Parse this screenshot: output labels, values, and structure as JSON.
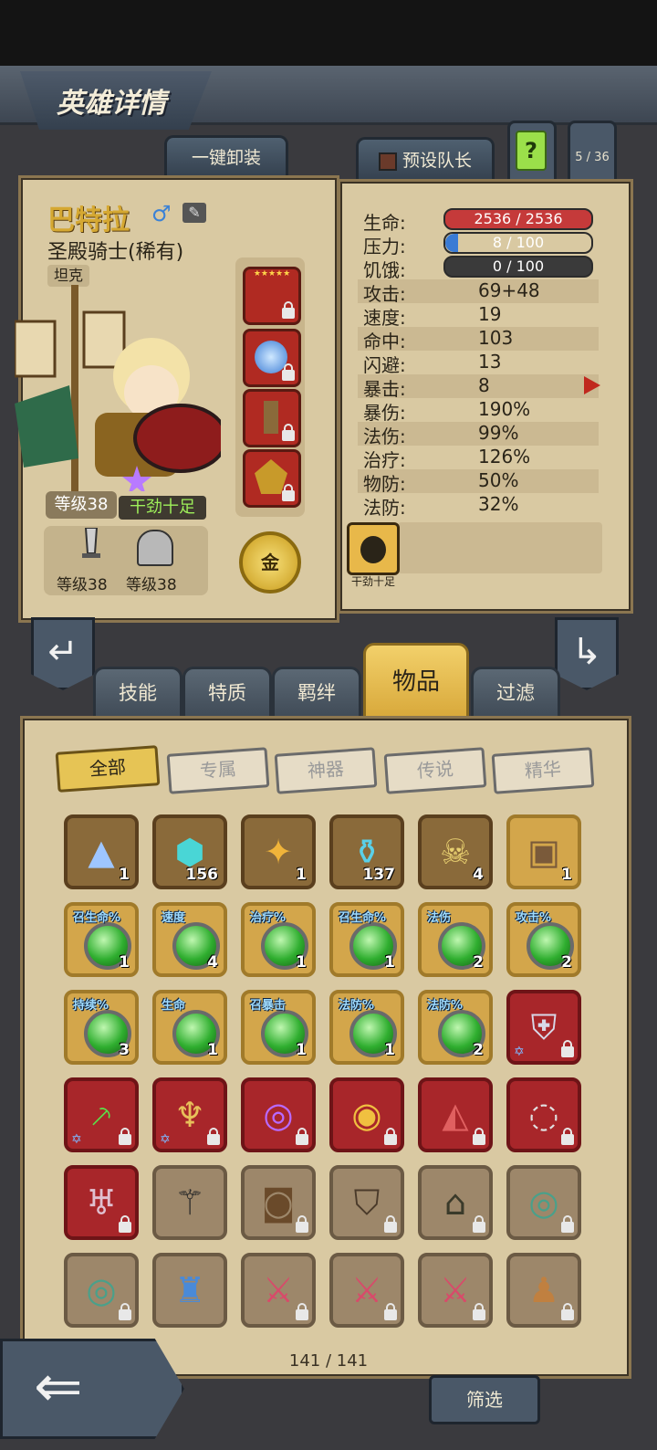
{
  "header": {
    "title": "英雄详情"
  },
  "top_buttons": {
    "unequip_all": "一键卸装",
    "preset_captain": "预设队长",
    "help": "?",
    "team_count": "5 / 36"
  },
  "hero": {
    "name": "巴特拉",
    "class_name": "圣殿骑士(稀有)",
    "role": "坦克",
    "level": "等级38",
    "mood": "干劲十足",
    "weapon_level": "等级38",
    "armor_level": "等级38",
    "gold_badge": "金",
    "trait_label": "干劲十足"
  },
  "stats": {
    "health_label": "生命:",
    "health_value": "2536 / 2536",
    "health_fraction": 1.0,
    "stress_label": "压力:",
    "stress_value": "8 / 100",
    "stress_fraction": 0.08,
    "hunger_label": "饥饿:",
    "hunger_value": "0 / 100",
    "hunger_fraction": 0.0,
    "rows": [
      {
        "label": "攻击:",
        "value": "69+48"
      },
      {
        "label": "速度:",
        "value": "19"
      },
      {
        "label": "命中:",
        "value": "103"
      },
      {
        "label": "闪避:",
        "value": "13"
      },
      {
        "label": "暴击:",
        "value": "8"
      },
      {
        "label": "暴伤:",
        "value": "190%"
      },
      {
        "label": "法伤:",
        "value": "99%"
      },
      {
        "label": "治疗:",
        "value": "126%"
      },
      {
        "label": "物防:",
        "value": "50%"
      },
      {
        "label": "法防:",
        "value": "32%"
      }
    ]
  },
  "tabs": [
    "技能",
    "特质",
    "羁绊",
    "物品",
    "过滤"
  ],
  "filters": [
    "全部",
    "专属",
    "神器",
    "传说",
    "精华"
  ],
  "items_row1": [
    {
      "count": "1",
      "icon": "crystal-pile-icon"
    },
    {
      "count": "156",
      "icon": "rune-stone-icon"
    },
    {
      "count": "1",
      "icon": "feather-icon"
    },
    {
      "count": "137",
      "icon": "potion-icon"
    },
    {
      "count": "4",
      "icon": "skull-hood-icon"
    },
    {
      "count": "1",
      "icon": "chest-icon"
    }
  ],
  "items_row2": [
    {
      "tag": "召生命%",
      "count": "1"
    },
    {
      "tag": "速度",
      "count": "4"
    },
    {
      "tag": "治疗%",
      "count": "1"
    },
    {
      "tag": "召生命%",
      "count": "1"
    },
    {
      "tag": "法伤",
      "count": "2"
    },
    {
      "tag": "攻击%",
      "count": "2"
    }
  ],
  "items_row3": [
    {
      "tag": "持续%",
      "count": "3"
    },
    {
      "tag": "生命",
      "count": "1"
    },
    {
      "tag": "召暴击",
      "count": "1"
    },
    {
      "tag": "法防%",
      "count": "1"
    },
    {
      "tag": "法防%",
      "count": "2"
    }
  ],
  "inventory_count": "141 / 141",
  "filter_button": "筛选"
}
